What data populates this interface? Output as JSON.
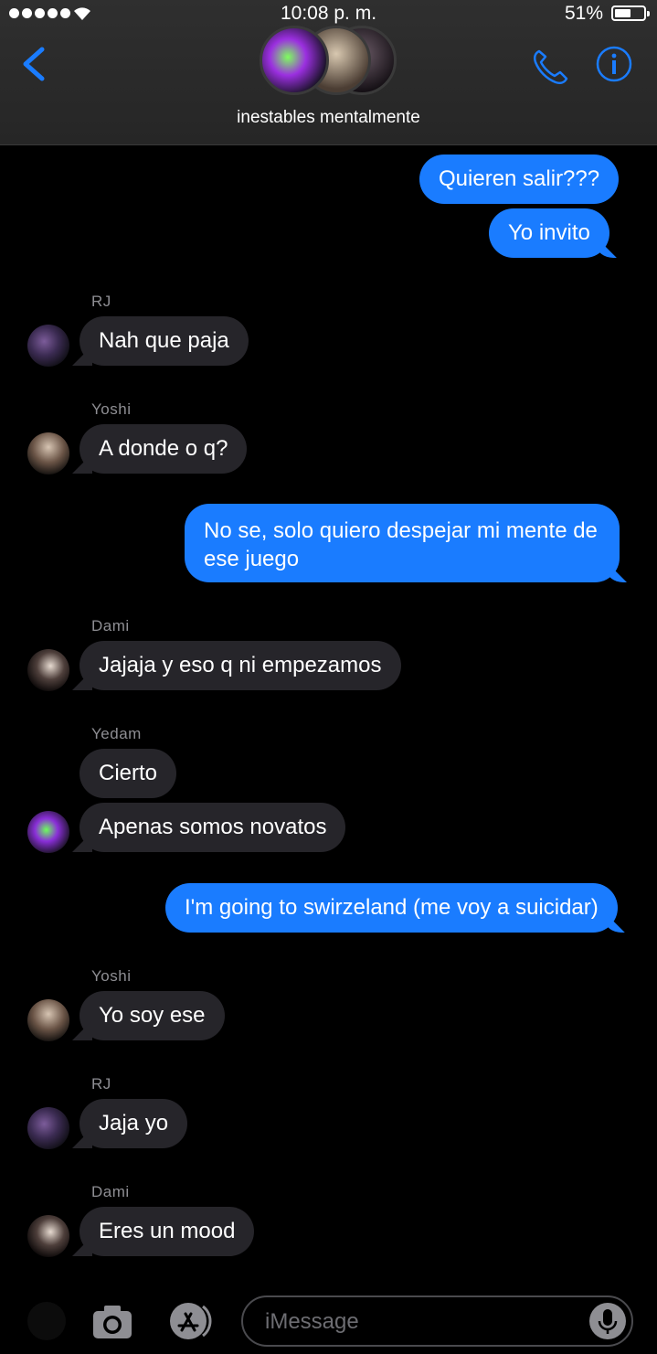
{
  "status": {
    "time": "10:08 p. m.",
    "battery": "51%"
  },
  "header": {
    "group_name": "inestables mentalmente"
  },
  "messages": [
    {
      "text": "Quieren salir???"
    },
    {
      "text": "Yo invito"
    },
    {
      "sender": "RJ",
      "text": "Nah que paja"
    },
    {
      "sender": "Yoshi",
      "text": "A donde o q?"
    },
    {
      "text": "No se, solo quiero despejar mi mente de ese juego"
    },
    {
      "sender": "Dami",
      "text": "Jajaja y eso q ni empezamos"
    },
    {
      "sender": "Yedam",
      "text": "Cierto"
    },
    {
      "text": "Apenas somos novatos"
    },
    {
      "text": "I'm going to swirzeland (me voy a suicidar)"
    },
    {
      "sender": "Yoshi",
      "text": "Yo soy ese"
    },
    {
      "sender": "RJ",
      "text": "Jaja yo"
    },
    {
      "sender": "Dami",
      "text": "Eres un mood"
    }
  ],
  "composer": {
    "placeholder": "iMessage"
  },
  "colors": {
    "accent": "#1a7cff",
    "incoming_bubble": "#26252a",
    "background": "#000000"
  },
  "icons": [
    "back-chevron-icon",
    "phone-icon",
    "info-icon",
    "camera-icon",
    "app-store-icon",
    "microphone-icon"
  ]
}
